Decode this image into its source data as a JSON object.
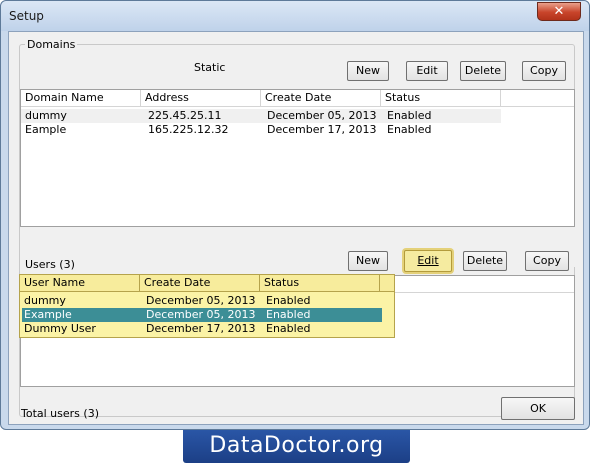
{
  "window": {
    "title": "Setup",
    "close_symbol": "✕"
  },
  "domains": {
    "group_label": "Domains",
    "static_label": "Static",
    "buttons": {
      "new": "New",
      "edit": "Edit",
      "delete": "Delete",
      "copy": "Copy"
    },
    "columns": [
      "Domain Name",
      "Address",
      "Create Date",
      "Status"
    ],
    "rows": [
      {
        "name": "dummy",
        "address": "225.45.25.11",
        "create_date": "December 05, 2013",
        "status": "Enabled"
      },
      {
        "name": "Eample",
        "address": "165.225.12.32",
        "create_date": "December 17, 2013",
        "status": "Enabled"
      }
    ]
  },
  "users": {
    "label": "Users (3)",
    "buttons": {
      "new": "New",
      "edit": "Edit",
      "delete": "Delete",
      "copy": "Copy"
    },
    "columns": [
      "User Name",
      "Create Date",
      "Status"
    ],
    "rows": [
      {
        "name": "dummy",
        "create_date": "December 05, 2013",
        "status": "Enabled",
        "selected": false
      },
      {
        "name": "Example",
        "create_date": "December 05, 2013",
        "status": "Enabled",
        "selected": true
      },
      {
        "name": "Dummy User",
        "create_date": "December 17, 2013",
        "status": "Enabled",
        "selected": false
      }
    ],
    "total_label": "Total users (3)"
  },
  "ok_button": "OK",
  "banner": "DataDoctor.org",
  "colors": {
    "highlight_fill": "#fbf3a6",
    "selected_row": "#3c8e96",
    "banner_blue": "#2a56a6",
    "close_red": "#c8442a"
  }
}
